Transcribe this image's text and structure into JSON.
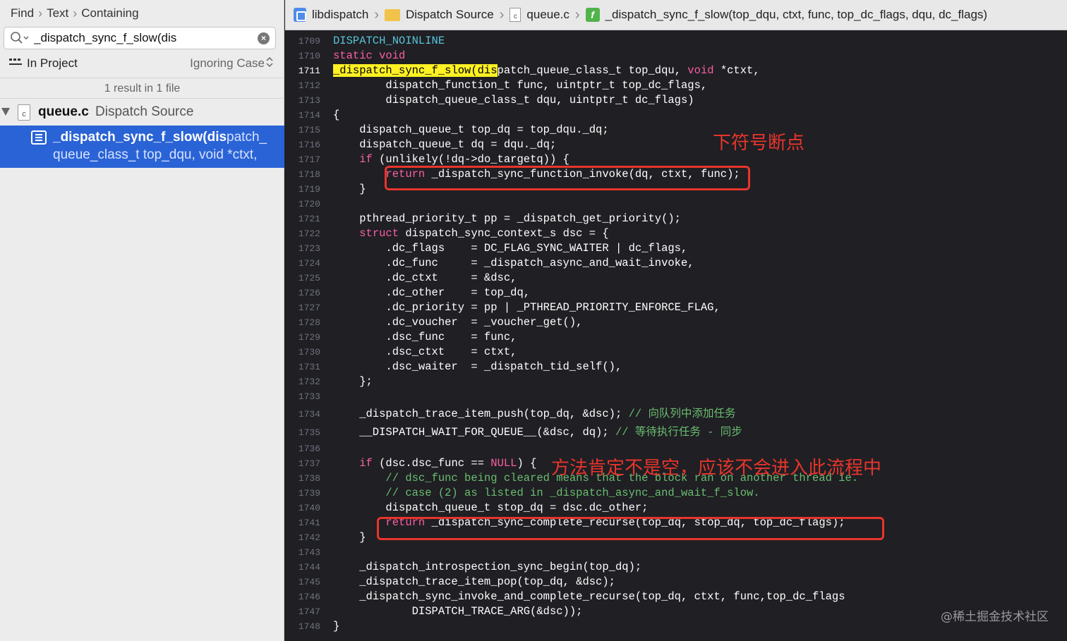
{
  "navigator": {
    "breadcrumb": [
      "Find",
      "Text",
      "Containing"
    ],
    "search_value": "_dispatch_sync_f_slow(dis",
    "scope_label": "In Project",
    "case_label": "Ignoring Case",
    "result_count": "1 result in 1 file",
    "file": {
      "name": "queue.c",
      "group": "Dispatch Source"
    },
    "result": {
      "match": "_dispatch_sync_f_slow(dis",
      "rest_line1": "patch_",
      "line2": "queue_class_t top_dqu, void *ctxt,"
    }
  },
  "jump_bar": {
    "project": "libdispatch",
    "folder": "Dispatch Source",
    "file": "queue.c",
    "function": "_dispatch_sync_f_slow(top_dqu, ctxt, func, top_dc_flags, dqu, dc_flags)"
  },
  "icons": {
    "search": "search-icon",
    "clear": "clear-search-icon",
    "scope": "scope-icon",
    "file": "c-file-icon",
    "result": "text-result-icon",
    "project": "project-icon",
    "folder": "folder-icon",
    "function": "function-icon"
  },
  "colors": {
    "editor_bg": "#1f1f24",
    "keyword": "#fc5fa3",
    "macro": "#58c3d7",
    "comment": "#6bbd6e",
    "highlight": "#fff123",
    "annotation": "#e8352b",
    "selection": "#2a63d6"
  },
  "editor": {
    "current_line": "1711",
    "lines": [
      {
        "n": "1709",
        "t": [
          {
            "c": "mac",
            "s": "DISPATCH_NOINLINE"
          }
        ]
      },
      {
        "n": "1710",
        "t": [
          {
            "c": "kw",
            "s": "static void"
          }
        ]
      },
      {
        "n": "1711",
        "t": [
          {
            "c": "hl",
            "s": "_dispatch_sync_f_slow(dis"
          },
          {
            "c": "",
            "s": "patch_queue_class_t top_dqu, "
          },
          {
            "c": "kw",
            "s": "void"
          },
          {
            "c": "",
            "s": " *ctxt,"
          }
        ]
      },
      {
        "n": "1712",
        "t": [
          {
            "c": "",
            "s": "        dispatch_function_t func, uintptr_t top_dc_flags,"
          }
        ]
      },
      {
        "n": "1713",
        "t": [
          {
            "c": "",
            "s": "        dispatch_queue_class_t dqu, uintptr_t dc_flags)"
          }
        ]
      },
      {
        "n": "1714",
        "t": [
          {
            "c": "",
            "s": "{"
          }
        ]
      },
      {
        "n": "1715",
        "t": [
          {
            "c": "",
            "s": "    dispatch_queue_t top_dq = top_dqu._dq;"
          }
        ]
      },
      {
        "n": "1716",
        "t": [
          {
            "c": "",
            "s": "    dispatch_queue_t dq = dqu._dq;"
          }
        ]
      },
      {
        "n": "1717",
        "t": [
          {
            "c": "",
            "s": "    "
          },
          {
            "c": "kw",
            "s": "if"
          },
          {
            "c": "",
            "s": " (unlikely(!dq->do_targetq)) {"
          }
        ]
      },
      {
        "n": "1718",
        "t": [
          {
            "c": "",
            "s": "        "
          },
          {
            "c": "kw",
            "s": "return"
          },
          {
            "c": "",
            "s": " _dispatch_sync_function_invoke(dq, ctxt, func);"
          }
        ]
      },
      {
        "n": "1719",
        "t": [
          {
            "c": "",
            "s": "    }"
          }
        ]
      },
      {
        "n": "1720",
        "t": [
          {
            "c": "",
            "s": ""
          }
        ]
      },
      {
        "n": "1721",
        "t": [
          {
            "c": "",
            "s": "    pthread_priority_t pp = _dispatch_get_priority();"
          }
        ]
      },
      {
        "n": "1722",
        "t": [
          {
            "c": "",
            "s": "    "
          },
          {
            "c": "kw",
            "s": "struct"
          },
          {
            "c": "",
            "s": " dispatch_sync_context_s dsc = {"
          }
        ]
      },
      {
        "n": "1723",
        "t": [
          {
            "c": "",
            "s": "        .dc_flags    = DC_FLAG_SYNC_WAITER | dc_flags,"
          }
        ]
      },
      {
        "n": "1724",
        "t": [
          {
            "c": "",
            "s": "        .dc_func     = _dispatch_async_and_wait_invoke,"
          }
        ]
      },
      {
        "n": "1725",
        "t": [
          {
            "c": "",
            "s": "        .dc_ctxt     = &dsc,"
          }
        ]
      },
      {
        "n": "1726",
        "t": [
          {
            "c": "",
            "s": "        .dc_other    = top_dq,"
          }
        ]
      },
      {
        "n": "1727",
        "t": [
          {
            "c": "",
            "s": "        .dc_priority = pp | _PTHREAD_PRIORITY_ENFORCE_FLAG,"
          }
        ]
      },
      {
        "n": "1728",
        "t": [
          {
            "c": "",
            "s": "        .dc_voucher  = _voucher_get(),"
          }
        ]
      },
      {
        "n": "1729",
        "t": [
          {
            "c": "",
            "s": "        .dsc_func    = func,"
          }
        ]
      },
      {
        "n": "1730",
        "t": [
          {
            "c": "",
            "s": "        .dsc_ctxt    = ctxt,"
          }
        ]
      },
      {
        "n": "1731",
        "t": [
          {
            "c": "",
            "s": "        .dsc_waiter  = _dispatch_tid_self(),"
          }
        ]
      },
      {
        "n": "1732",
        "t": [
          {
            "c": "",
            "s": "    };"
          }
        ]
      },
      {
        "n": "1733",
        "t": [
          {
            "c": "",
            "s": ""
          }
        ]
      },
      {
        "n": "1734",
        "t": [
          {
            "c": "",
            "s": "    _dispatch_trace_item_push(top_dq, &dsc); "
          },
          {
            "c": "cm",
            "s": "// 向队列中添加任务"
          }
        ]
      },
      {
        "n": "1735",
        "t": [
          {
            "c": "",
            "s": "    __DISPATCH_WAIT_FOR_QUEUE__(&dsc, dq); "
          },
          {
            "c": "cm",
            "s": "// 等待执行任务 - 同步"
          }
        ]
      },
      {
        "n": "1736",
        "t": [
          {
            "c": "",
            "s": ""
          }
        ]
      },
      {
        "n": "1737",
        "t": [
          {
            "c": "",
            "s": "    "
          },
          {
            "c": "kw",
            "s": "if"
          },
          {
            "c": "",
            "s": " (dsc.dsc_func == "
          },
          {
            "c": "kw",
            "s": "NULL"
          },
          {
            "c": "",
            "s": ") {"
          }
        ]
      },
      {
        "n": "1738",
        "t": [
          {
            "c": "",
            "s": "        "
          },
          {
            "c": "cm",
            "s": "// dsc_func being cleared means that the block ran on another thread ie."
          }
        ]
      },
      {
        "n": "1739",
        "t": [
          {
            "c": "",
            "s": "        "
          },
          {
            "c": "cm",
            "s": "// case (2) as listed in _dispatch_async_and_wait_f_slow."
          }
        ]
      },
      {
        "n": "1740",
        "t": [
          {
            "c": "",
            "s": "        dispatch_queue_t stop_dq = dsc.dc_other;"
          }
        ]
      },
      {
        "n": "1741",
        "t": [
          {
            "c": "",
            "s": "        "
          },
          {
            "c": "kw",
            "s": "return"
          },
          {
            "c": "",
            "s": " _dispatch_sync_complete_recurse(top_dq, stop_dq, top_dc_flags);"
          }
        ]
      },
      {
        "n": "1742",
        "t": [
          {
            "c": "",
            "s": "    }"
          }
        ]
      },
      {
        "n": "1743",
        "t": [
          {
            "c": "",
            "s": ""
          }
        ]
      },
      {
        "n": "1744",
        "t": [
          {
            "c": "",
            "s": "    _dispatch_introspection_sync_begin(top_dq);"
          }
        ]
      },
      {
        "n": "1745",
        "t": [
          {
            "c": "",
            "s": "    _dispatch_trace_item_pop(top_dq, &dsc);"
          }
        ]
      },
      {
        "n": "1746",
        "t": [
          {
            "c": "",
            "s": "    _dispatch_sync_invoke_and_complete_recurse(top_dq, ctxt, func,top_dc_flags"
          }
        ]
      },
      {
        "n": "1747",
        "t": [
          {
            "c": "",
            "s": "            DISPATCH_TRACE_ARG(&dsc));"
          }
        ]
      },
      {
        "n": "1748",
        "t": [
          {
            "c": "",
            "s": "}"
          }
        ]
      }
    ]
  },
  "annotations": {
    "breakpoint_note": "下符号断点",
    "flow_note": "方法肯定不是空，应该不会进入此流程中"
  },
  "watermark": "@稀土掘金技术社区"
}
